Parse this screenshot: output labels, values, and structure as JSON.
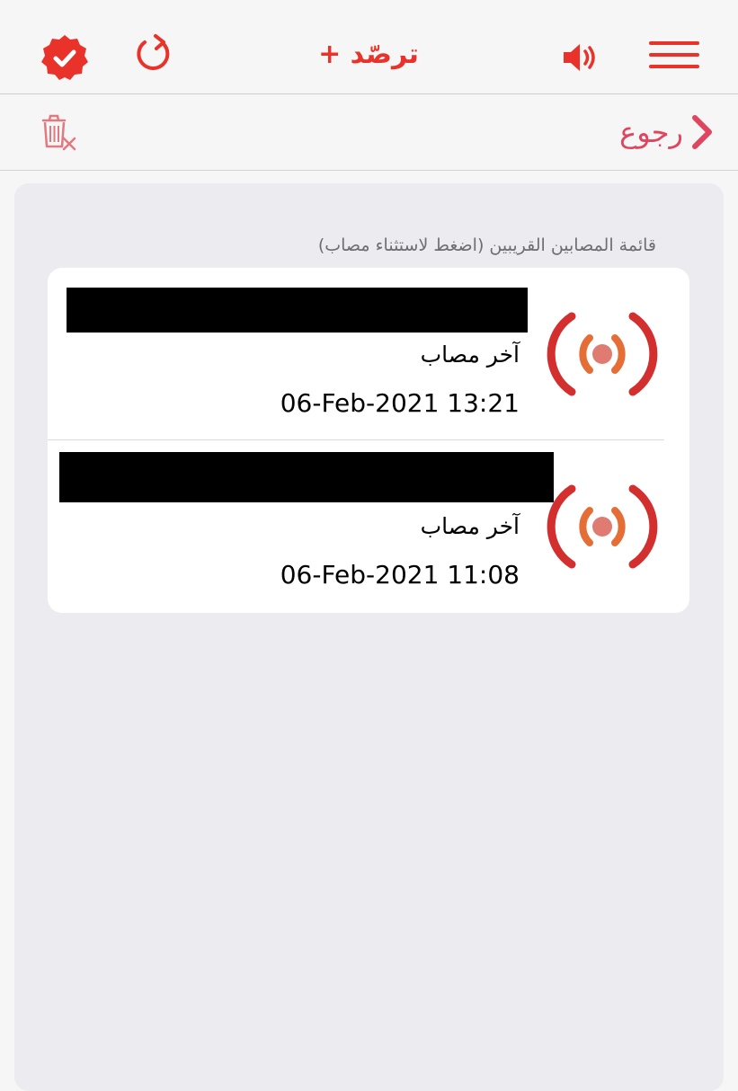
{
  "header": {
    "title": "ترصّد +",
    "icons": {
      "verified": "verified-badge-icon",
      "refresh": "refresh-icon",
      "sound": "speaker-icon",
      "menu": "hamburger-menu-icon"
    },
    "accent_color": "#e8322a"
  },
  "navbar": {
    "back_label": "رجوع",
    "back_color": "#e0455f",
    "delete_icon": "delete-trash-icon"
  },
  "section": {
    "caption": "قائمة المصابين القريبين (اضغط لاستثناء مصاب)"
  },
  "items": [
    {
      "label": "آخر مصاب",
      "time": "06-Feb-2021 13:21",
      "icon": "broadcast-signal-icon"
    },
    {
      "label": "آخر مصاب",
      "time": "06-Feb-2021 11:08",
      "icon": "broadcast-signal-icon"
    }
  ]
}
